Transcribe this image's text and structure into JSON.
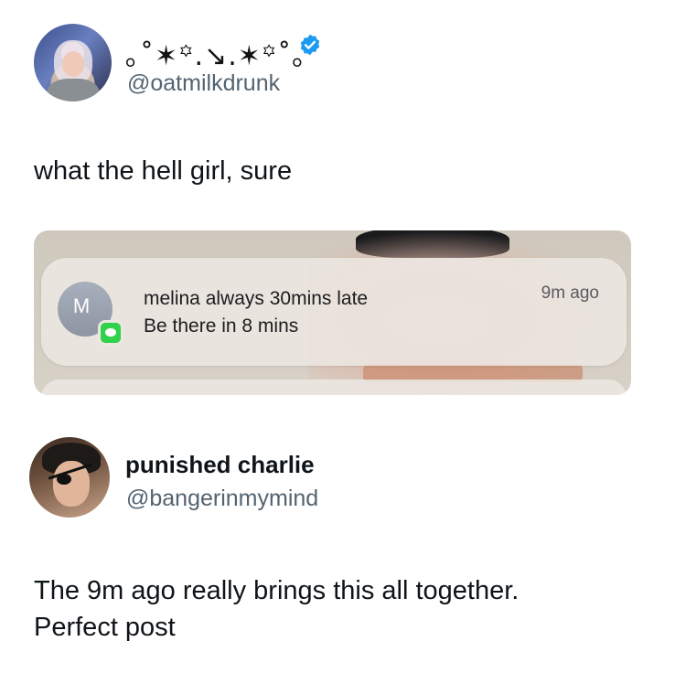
{
  "post": {
    "display_name": "｡˚✶꙳.↘.✶꙳˚｡",
    "handle": "@oatmilkdrunk",
    "verified": true,
    "text": "what the hell girl, sure"
  },
  "notification": {
    "avatar_letter": "M",
    "title": "melina always 30mins late",
    "body": "Be there in 8 mins",
    "time": "9m ago",
    "app_icon": "messages-icon"
  },
  "reply": {
    "display_name": "punished charlie",
    "handle": "@bangerinmymind",
    "text_line1": "The 9m ago really brings this all together.",
    "text_line2": "Perfect post"
  },
  "colors": {
    "verified_blue": "#1d9bf0",
    "handle_gray": "#536471",
    "messages_green": "#2fd24a"
  }
}
